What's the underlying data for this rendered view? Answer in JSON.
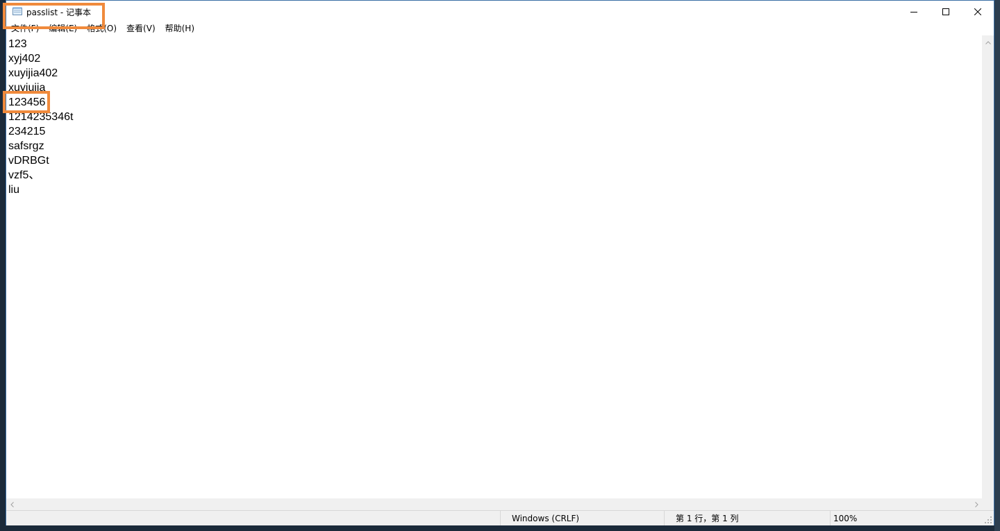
{
  "window": {
    "title": "passlist - 记事本",
    "icon": "notepad-icon"
  },
  "menu": [
    {
      "label": "文件(F)"
    },
    {
      "label": "编辑(E)"
    },
    {
      "label": "格式(O)"
    },
    {
      "label": "查看(V)"
    },
    {
      "label": "帮助(H)"
    }
  ],
  "editor": {
    "lines": [
      "123",
      "xyj402",
      "xuyijia402",
      "xuyiujia",
      "123456",
      "1214235346t",
      "234215",
      "safsrgz",
      "vDRBGt",
      "vzf5、",
      "liu"
    ]
  },
  "status": {
    "eol": "Windows (CRLF)",
    "position": "第 1 行，第 1 列",
    "zoom": "100%"
  },
  "colors": {
    "highlight": "#f08a3c",
    "chrome": "#f0f0f0"
  }
}
